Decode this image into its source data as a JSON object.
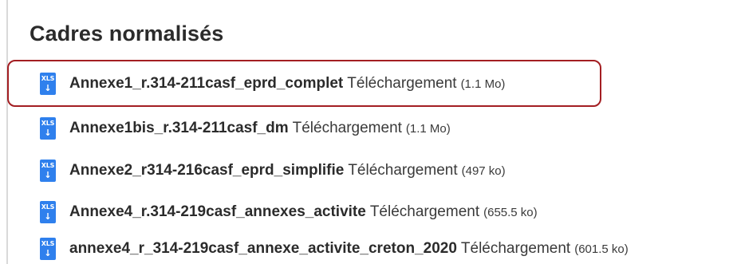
{
  "section": {
    "title": "Cadres normalisés"
  },
  "colors": {
    "highlight_border": "#a31e22",
    "icon_background": "#2f80ed"
  },
  "files": [
    {
      "icon": "xls-download-icon",
      "icon_ext": "XLS",
      "icon_arrow": "↓",
      "name": "Annexe1_r.314-211casf_eprd_complet",
      "download_label": "Téléchargement",
      "size": "(1.1 Mo)",
      "highlighted": true
    },
    {
      "icon": "xls-download-icon",
      "icon_ext": "XLS",
      "icon_arrow": "↓",
      "name": "Annexe1bis_r.314-211casf_dm",
      "download_label": "Téléchargement",
      "size": "(1.1 Mo)",
      "highlighted": false
    },
    {
      "icon": "xls-download-icon",
      "icon_ext": "XLS",
      "icon_arrow": "↓",
      "name": "Annexe2_r314-216casf_eprd_simplifie",
      "download_label": "Téléchargement",
      "size": "(497 ko)",
      "highlighted": false
    },
    {
      "icon": "xls-download-icon",
      "icon_ext": "XLS",
      "icon_arrow": "↓",
      "name": "Annexe4_r.314-219casf_annexes_activite",
      "download_label": "Téléchargement",
      "size": "(655.5 ko)",
      "highlighted": false
    },
    {
      "icon": "xls-download-icon",
      "icon_ext": "XLS",
      "icon_arrow": "↓",
      "name": "annexe4_r_314-219casf_annexe_activite_creton_2020",
      "download_label": "Téléchargement",
      "size": "(601.5 ko)",
      "highlighted": false
    }
  ]
}
